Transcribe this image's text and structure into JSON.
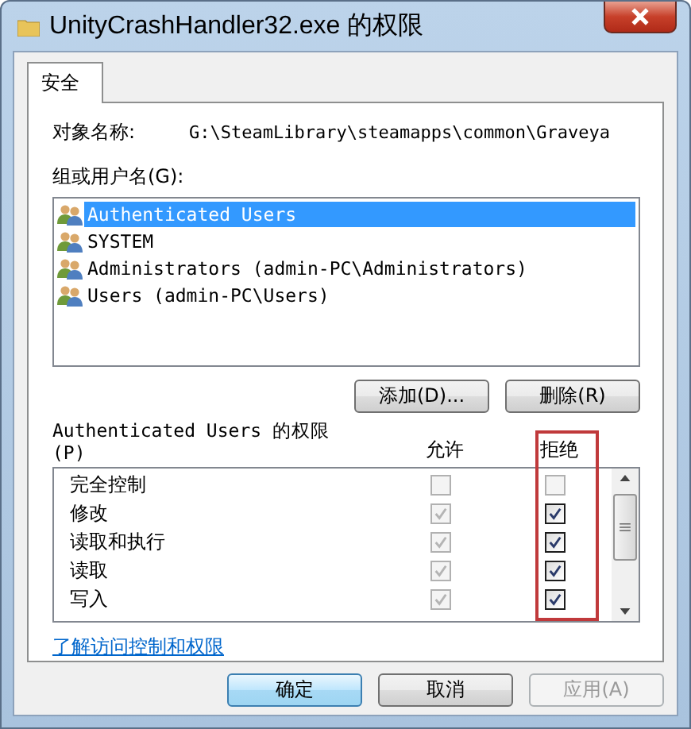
{
  "window": {
    "title": "UnityCrashHandler32.exe 的权限"
  },
  "tabs": [
    {
      "label": "安全",
      "selected": true
    }
  ],
  "object_name": {
    "label": "对象名称:",
    "value": "G:\\SteamLibrary\\steamapps\\common\\Graveya"
  },
  "groups": {
    "label": "组或用户名(G):",
    "items": [
      {
        "name": "Authenticated Users",
        "selected": true
      },
      {
        "name": "SYSTEM",
        "selected": false
      },
      {
        "name": "Administrators (admin-PC\\Administrators)",
        "selected": false
      },
      {
        "name": "Users (admin-PC\\Users)",
        "selected": false
      }
    ],
    "buttons": [
      "添加(D)...",
      "删除(R)"
    ]
  },
  "permissions": {
    "label": "Authenticated Users 的权限",
    "label_key": "(P)",
    "allow_header": "允许",
    "deny_header": "拒绝",
    "highlight_deny": true,
    "rows": [
      {
        "name": "完全控制",
        "allow": {
          "checked": false,
          "disabled": true
        },
        "deny": {
          "checked": false,
          "disabled": true
        }
      },
      {
        "name": "修改",
        "allow": {
          "checked": true,
          "disabled": true
        },
        "deny": {
          "checked": true,
          "disabled": false
        }
      },
      {
        "name": "读取和执行",
        "allow": {
          "checked": true,
          "disabled": true
        },
        "deny": {
          "checked": true,
          "disabled": false
        }
      },
      {
        "name": "读取",
        "allow": {
          "checked": true,
          "disabled": true
        },
        "deny": {
          "checked": true,
          "disabled": false
        }
      },
      {
        "name": "写入",
        "allow": {
          "checked": true,
          "disabled": true
        },
        "deny": {
          "checked": true,
          "disabled": false
        }
      }
    ]
  },
  "link": "了解访问控制和权限",
  "footer_buttons": [
    {
      "label": "确定",
      "kind": "default",
      "disabled": false
    },
    {
      "label": "取消",
      "kind": "normal",
      "disabled": false
    },
    {
      "label": "应用(A)",
      "kind": "normal",
      "disabled": true
    }
  ]
}
